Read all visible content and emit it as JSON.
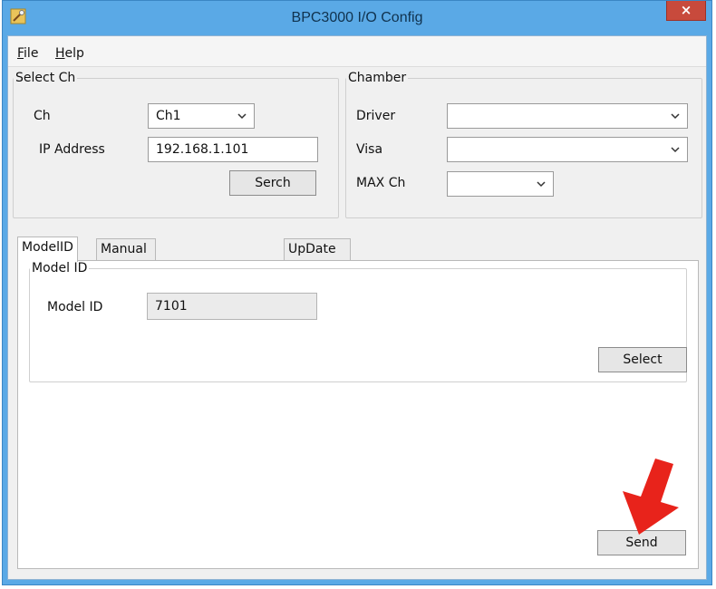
{
  "window": {
    "title": "BPC3000 I/O Config",
    "close_glyph": "×",
    "app_icon": "app-icon"
  },
  "menu": {
    "file": {
      "accel": "F",
      "rest": "ile"
    },
    "help": {
      "accel": "H",
      "rest": "elp"
    }
  },
  "select_ch": {
    "legend": "Select Ch",
    "ch_label": "Ch",
    "ch_value": "Ch1",
    "ip_label": "IP Address",
    "ip_value": "192.168.1.101",
    "search_button": "Serch"
  },
  "chamber": {
    "legend": "Chamber",
    "driver_label": "Driver",
    "driver_value": "",
    "visa_label": "Visa",
    "visa_value": "",
    "maxch_label": "MAX Ch",
    "maxch_value": ""
  },
  "tabs": [
    {
      "label": "ModelID",
      "active": true
    },
    {
      "label": "Manual Set IP Address",
      "active": false
    },
    {
      "label": "UpDate Firmware",
      "active": false
    }
  ],
  "model_panel": {
    "legend": "Model ID",
    "model_label": "Model ID",
    "model_value": "7101",
    "select_button": "Select"
  },
  "footer": {
    "send_button": "Send"
  },
  "colors": {
    "title_bar": "#5aa9e6",
    "close_button": "#c84a3c",
    "annotation_arrow": "#e8231b"
  }
}
